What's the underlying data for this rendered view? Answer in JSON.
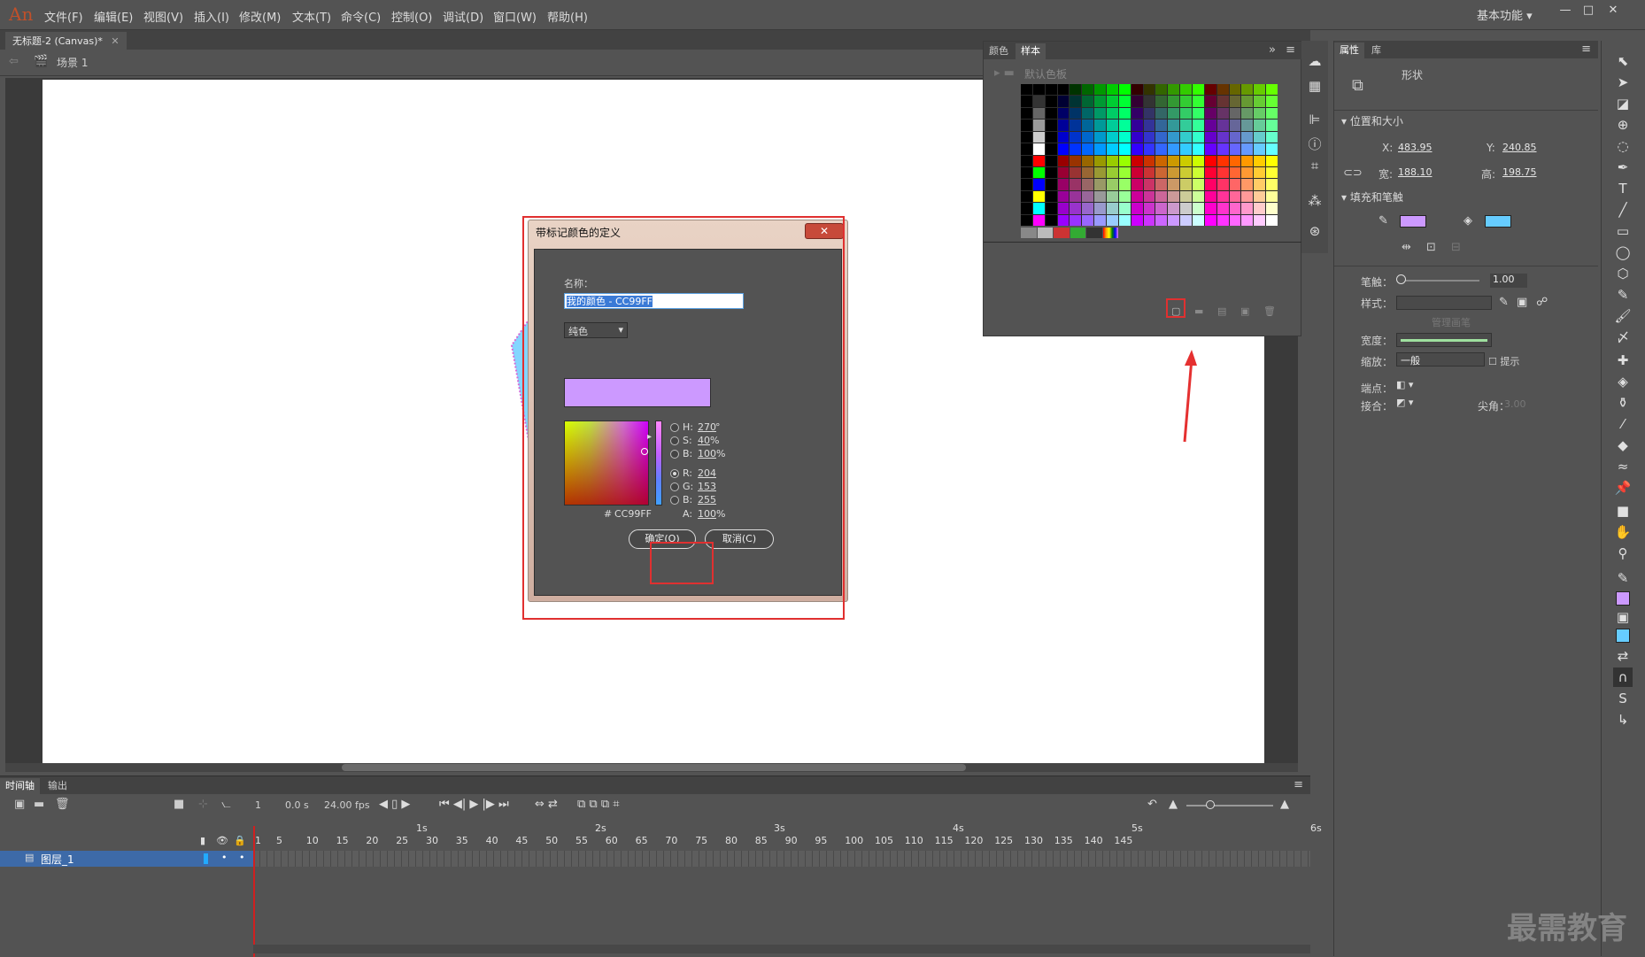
{
  "app": {
    "logo": "An",
    "menu": [
      "文件(F)",
      "编辑(E)",
      "视图(V)",
      "插入(I)",
      "修改(M)",
      "文本(T)",
      "命令(C)",
      "控制(O)",
      "调试(D)",
      "窗口(W)",
      "帮助(H)"
    ],
    "workspace": "基本功能",
    "doc_tab": "无标题-2 (Canvas)*",
    "scene": "场景 1"
  },
  "dialog": {
    "title": "带标记颜色的定义",
    "name_label": "名称：",
    "name_value": "我的颜色 - CC99FF",
    "fill_type": "纯色",
    "preview_color": "#CC99FF",
    "h_label": "H:",
    "h_value": "270",
    "h_unit": "°",
    "s_label": "S:",
    "s_value": "40",
    "s_unit": "%",
    "b_label": "B:",
    "b_value": "100",
    "b_unit": "%",
    "r_label": "R:",
    "r_value": "204",
    "g_label": "G:",
    "g_value": "153",
    "b2_label": "B:",
    "b2_value": "255",
    "hash": "#",
    "hex_value": "CC99FF",
    "a_label": "A:",
    "a_value": "100",
    "a_unit": "%",
    "ok_label": "确定(O)",
    "cancel_label": "取消(C)"
  },
  "swatches": {
    "tab_color": "颜色",
    "tab_samples": "样本",
    "folder_name": "默认色板"
  },
  "properties": {
    "tab_props": "属性",
    "tab_library": "库",
    "shape": "形状",
    "pos_size": "位置和大小",
    "x_label": "X:",
    "x_value": "483.95",
    "y_label": "Y:",
    "y_value": "240.85",
    "w_label": "宽:",
    "w_value": "188.10",
    "h_label": "高:",
    "h_value": "198.75",
    "fill_stroke": "填充和笔触",
    "stroke_color": "#CC99FF",
    "fill_color": "#66CCFF",
    "stroke_label": "笔触：",
    "stroke_value": "1.00",
    "style_label": "样式：",
    "manage_brush": "管理画笔",
    "width_label": "宽度：",
    "scale_label": "缩放：",
    "scale_value": "一般",
    "hint_label": "提示",
    "cap_label": "端点：",
    "join_label": "接合：",
    "miter_label": "尖角：",
    "miter_value": "3.00"
  },
  "timeline": {
    "tab_timeline": "时间轴",
    "tab_output": "输出",
    "frame": "1",
    "time": "0.0 s",
    "fps": "24.00 fps",
    "layer_name": "图层_1",
    "seconds": [
      "1s",
      "2s",
      "3s",
      "4s",
      "5s",
      "6s"
    ],
    "ticks": [
      "1",
      "5",
      "10",
      "15",
      "20",
      "25",
      "30",
      "35",
      "40",
      "45",
      "50",
      "55",
      "60",
      "65",
      "70",
      "75",
      "80",
      "85",
      "90",
      "95",
      "100",
      "105",
      "110",
      "115",
      "120",
      "125",
      "130",
      "135",
      "140",
      "145"
    ]
  },
  "watermark": "最需教育"
}
